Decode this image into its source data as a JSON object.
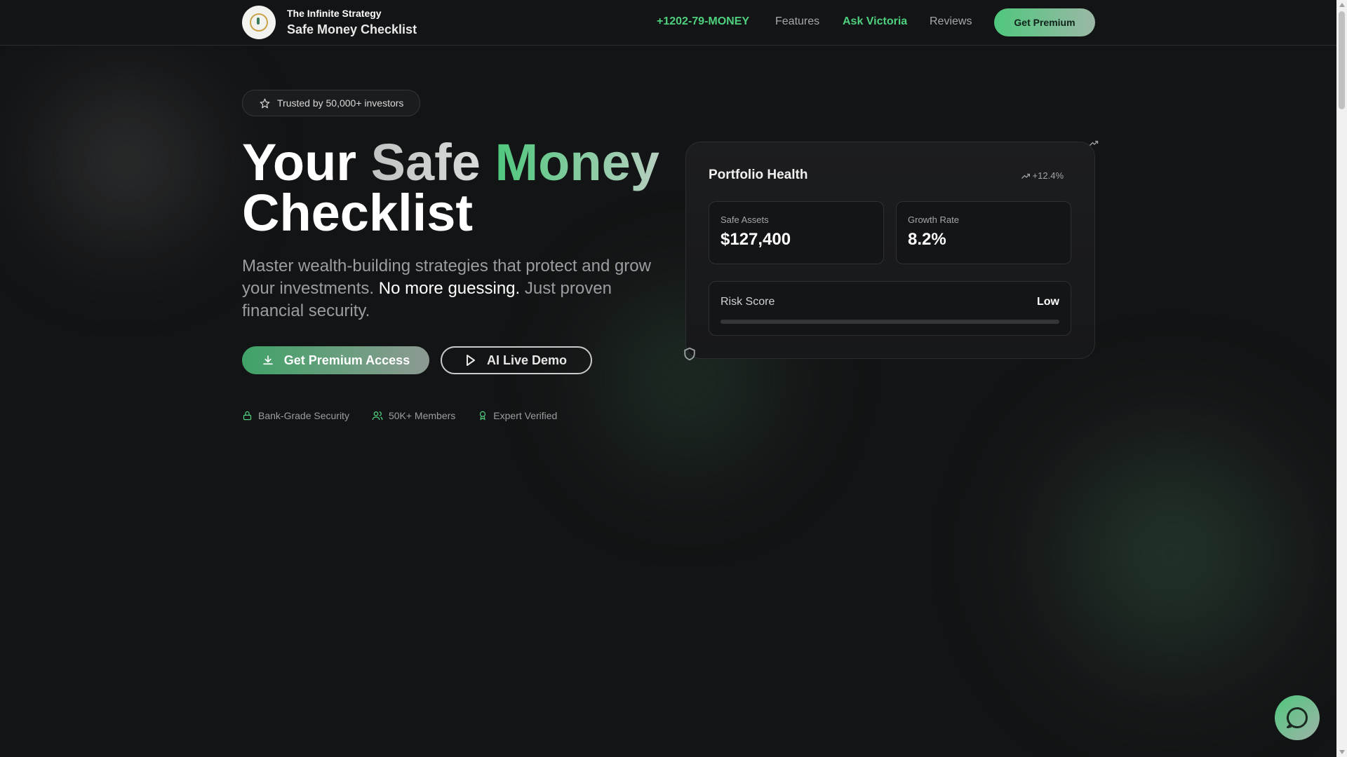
{
  "header": {
    "brand_top": "The Infinite Strategy",
    "brand_main": "Safe Money Checklist",
    "phone": "+1202-79-MONEY",
    "nav_features": "Features",
    "nav_ask": "Ask Victoria",
    "nav_reviews": "Reviews",
    "premium_button": "Get Premium"
  },
  "hero": {
    "trusted_badge": "Trusted by 50,000+ investors",
    "title_your": "Your",
    "title_safe": "Safe",
    "title_money": "Money",
    "title_checklist": "Checklist",
    "subtitle_1": "Master wealth-building strategies that protect and grow your investments.",
    "subtitle_highlight": "No more guessing.",
    "subtitle_2": "Just proven financial security.",
    "primary_button": "Get Premium Access",
    "secondary_button": "AI Live Demo",
    "features": [
      "Bank-Grade Security",
      "50K+ Members",
      "Expert Verified"
    ]
  },
  "card": {
    "title": "Portfolio Health",
    "trend": "+12.4%",
    "safe_assets_label": "Safe Assets",
    "safe_assets_value": "$127,400",
    "growth_label": "Growth Rate",
    "growth_value": "8.2%",
    "risk_label": "Risk Score",
    "risk_value": "Low",
    "risk_level": 0
  },
  "colors": {
    "accent": "#4fd07f",
    "background": "#131415"
  },
  "icons": {
    "star": "star-icon",
    "download": "download-icon",
    "play": "play-icon",
    "lock": "lock-icon",
    "users": "users-icon",
    "award": "award-icon",
    "trend": "trending-up-icon",
    "chat": "chat-icon"
  }
}
